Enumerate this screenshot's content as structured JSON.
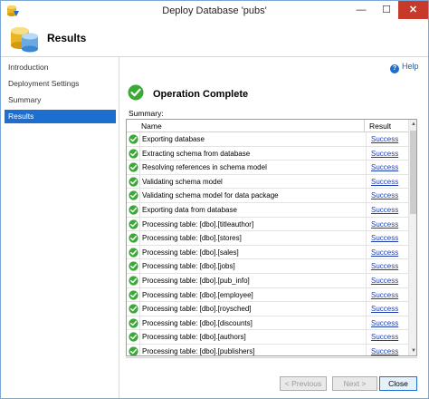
{
  "window": {
    "title": "Deploy Database 'pubs'"
  },
  "titlebar": {
    "min": "—",
    "max": "☐",
    "close": "✕"
  },
  "header": {
    "title": "Results"
  },
  "sidebar": {
    "items": [
      {
        "label": "Introduction",
        "active": false
      },
      {
        "label": "Deployment Settings",
        "active": false
      },
      {
        "label": "Summary",
        "active": false
      },
      {
        "label": "Results",
        "active": true
      }
    ]
  },
  "main": {
    "help_label": "Help",
    "operation_title": "Operation Complete",
    "summary_label": "Summary:",
    "columns": {
      "name": "Name",
      "result": "Result"
    },
    "rows": [
      {
        "name": "Exporting database",
        "result": "Success"
      },
      {
        "name": "Extracting schema from database",
        "result": "Success"
      },
      {
        "name": "Resolving references in schema model",
        "result": "Success"
      },
      {
        "name": "Validating schema model",
        "result": "Success"
      },
      {
        "name": "Validating schema model for data package",
        "result": "Success"
      },
      {
        "name": "Exporting data from database",
        "result": "Success"
      },
      {
        "name": "Processing table: [dbo].[titleauthor]",
        "result": "Success"
      },
      {
        "name": "Processing table: [dbo].[stores]",
        "result": "Success"
      },
      {
        "name": "Processing table: [dbo].[sales]",
        "result": "Success"
      },
      {
        "name": "Processing table: [dbo].[jobs]",
        "result": "Success"
      },
      {
        "name": "Processing table: [dbo].[pub_info]",
        "result": "Success"
      },
      {
        "name": "Processing table: [dbo].[employee]",
        "result": "Success"
      },
      {
        "name": "Processing table: [dbo].[roysched]",
        "result": "Success"
      },
      {
        "name": "Processing table: [dbo].[discounts]",
        "result": "Success"
      },
      {
        "name": "Processing table: [dbo].[authors]",
        "result": "Success"
      },
      {
        "name": "Processing table: [dbo].[publishers]",
        "result": "Success"
      }
    ]
  },
  "footer": {
    "previous_label": "< Previous",
    "next_label": "Next >",
    "close_label": "Close"
  },
  "colors": {
    "accent": "#1c6ecf",
    "success": "#3aa935",
    "close_button": "#c7392b"
  },
  "icons": {
    "window": "database-deploy-icon",
    "header": "database-cylinders-icon",
    "status": "check-circle-icon",
    "help": "help-icon"
  }
}
